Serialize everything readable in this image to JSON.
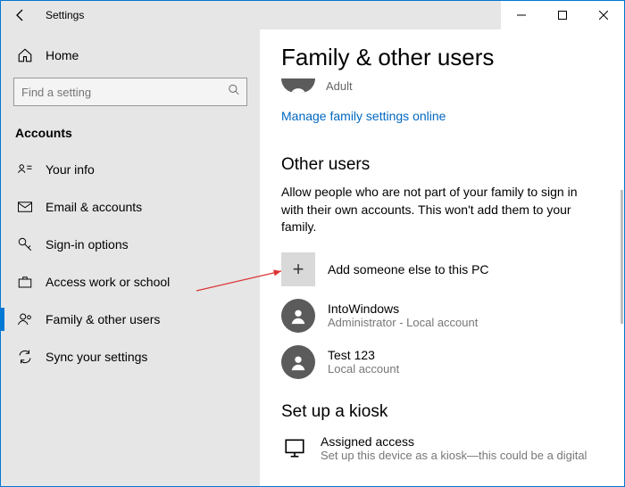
{
  "window": {
    "title": "Settings"
  },
  "sidebar": {
    "home": "Home",
    "search_placeholder": "Find a setting",
    "section": "Accounts",
    "items": [
      {
        "label": "Your info"
      },
      {
        "label": "Email & accounts"
      },
      {
        "label": "Sign-in options"
      },
      {
        "label": "Access work or school"
      },
      {
        "label": "Family & other users"
      },
      {
        "label": "Sync your settings"
      }
    ],
    "active_index": 4
  },
  "main": {
    "title": "Family & other users",
    "family_member": {
      "role": "Adult"
    },
    "manage_link": "Manage family settings online",
    "other_users": {
      "heading": "Other users",
      "description": "Allow people who are not part of your family to sign in with their own accounts. This won't add them to your family.",
      "add_label": "Add someone else to this PC",
      "users": [
        {
          "name": "IntoWindows",
          "detail": "Administrator - Local account"
        },
        {
          "name": "Test 123",
          "detail": "Local account"
        }
      ]
    },
    "kiosk": {
      "heading": "Set up a kiosk",
      "item_title": "Assigned access",
      "item_sub": "Set up this device as a kiosk—this could be a digital"
    }
  }
}
